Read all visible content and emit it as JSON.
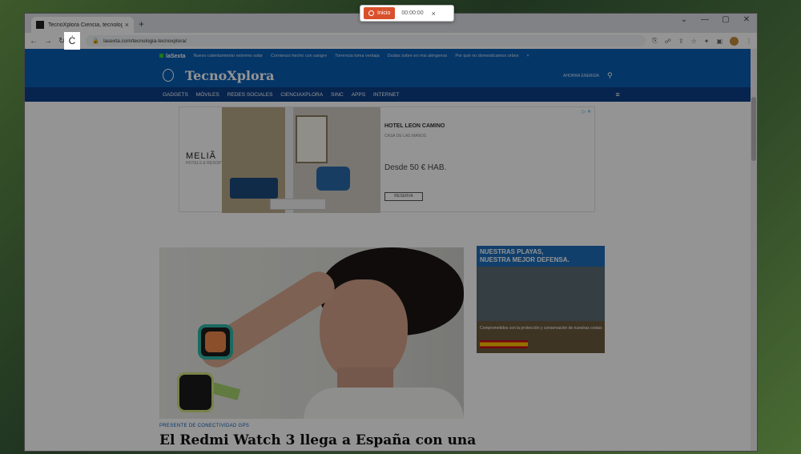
{
  "browser": {
    "tab_title": "TecnoXplora Ciencia, tecnología",
    "tab_close": "×",
    "new_tab": "+",
    "window_controls": [
      "⌄",
      "—",
      "▢",
      "✕"
    ],
    "back": "←",
    "forward": "→",
    "reload": "↻",
    "url": "lasexta.com/tecnologia-tecnoxplora/",
    "toolbar_icons": [
      "⎘",
      "☍",
      "⇪",
      "☆",
      "✦",
      "▣"
    ],
    "menu": "⋮"
  },
  "cursor_glyph": "Ċ",
  "site": {
    "network_brand": "laSexta",
    "ticker": [
      "Nuevo calentamiento extremo solar",
      "Comienzo hecho con sangre",
      "Torrencia toma ventaja",
      "Dudas sobre en mis alérgenos",
      "Por qué no domesticamos orbes"
    ],
    "ticker_close": "×",
    "logo": "TecnoXplora",
    "ahorra_label": "AHORRA ENERGÍA",
    "nav": [
      "GADGETS",
      "MÓVILES",
      "REDES SOCIALES",
      "CIENCIAXPLORA",
      "SINC",
      "APPS",
      "INTERNET"
    ],
    "menu_icon": "≡",
    "search_icon": "⚲"
  },
  "ad": {
    "brand": "MELIÃ",
    "brand_sub": "HOTELS & RESORTS",
    "hotel": "HOTEL LEON CAMINO",
    "hotel_sub": "CASA DE LAS MANOS",
    "price": "Desde 50 € HAB.",
    "cta": "RESERVA",
    "adchoices": "▷ ✕"
  },
  "side_ad": {
    "title_line1": "NUESTRAS PLAYAS,",
    "title_line2": "NUESTRA MEJOR DEFENSA.",
    "body": "Comprometidos con la protección y conservación de nuestras costas"
  },
  "article": {
    "kicker": "PRESENTE DE CONECTIVIDAD GPS",
    "headline": "El Redmi Watch 3 llega a España con una"
  },
  "recorder": {
    "button_label": "Inicio",
    "timer": "00:00:00",
    "close": "×"
  }
}
